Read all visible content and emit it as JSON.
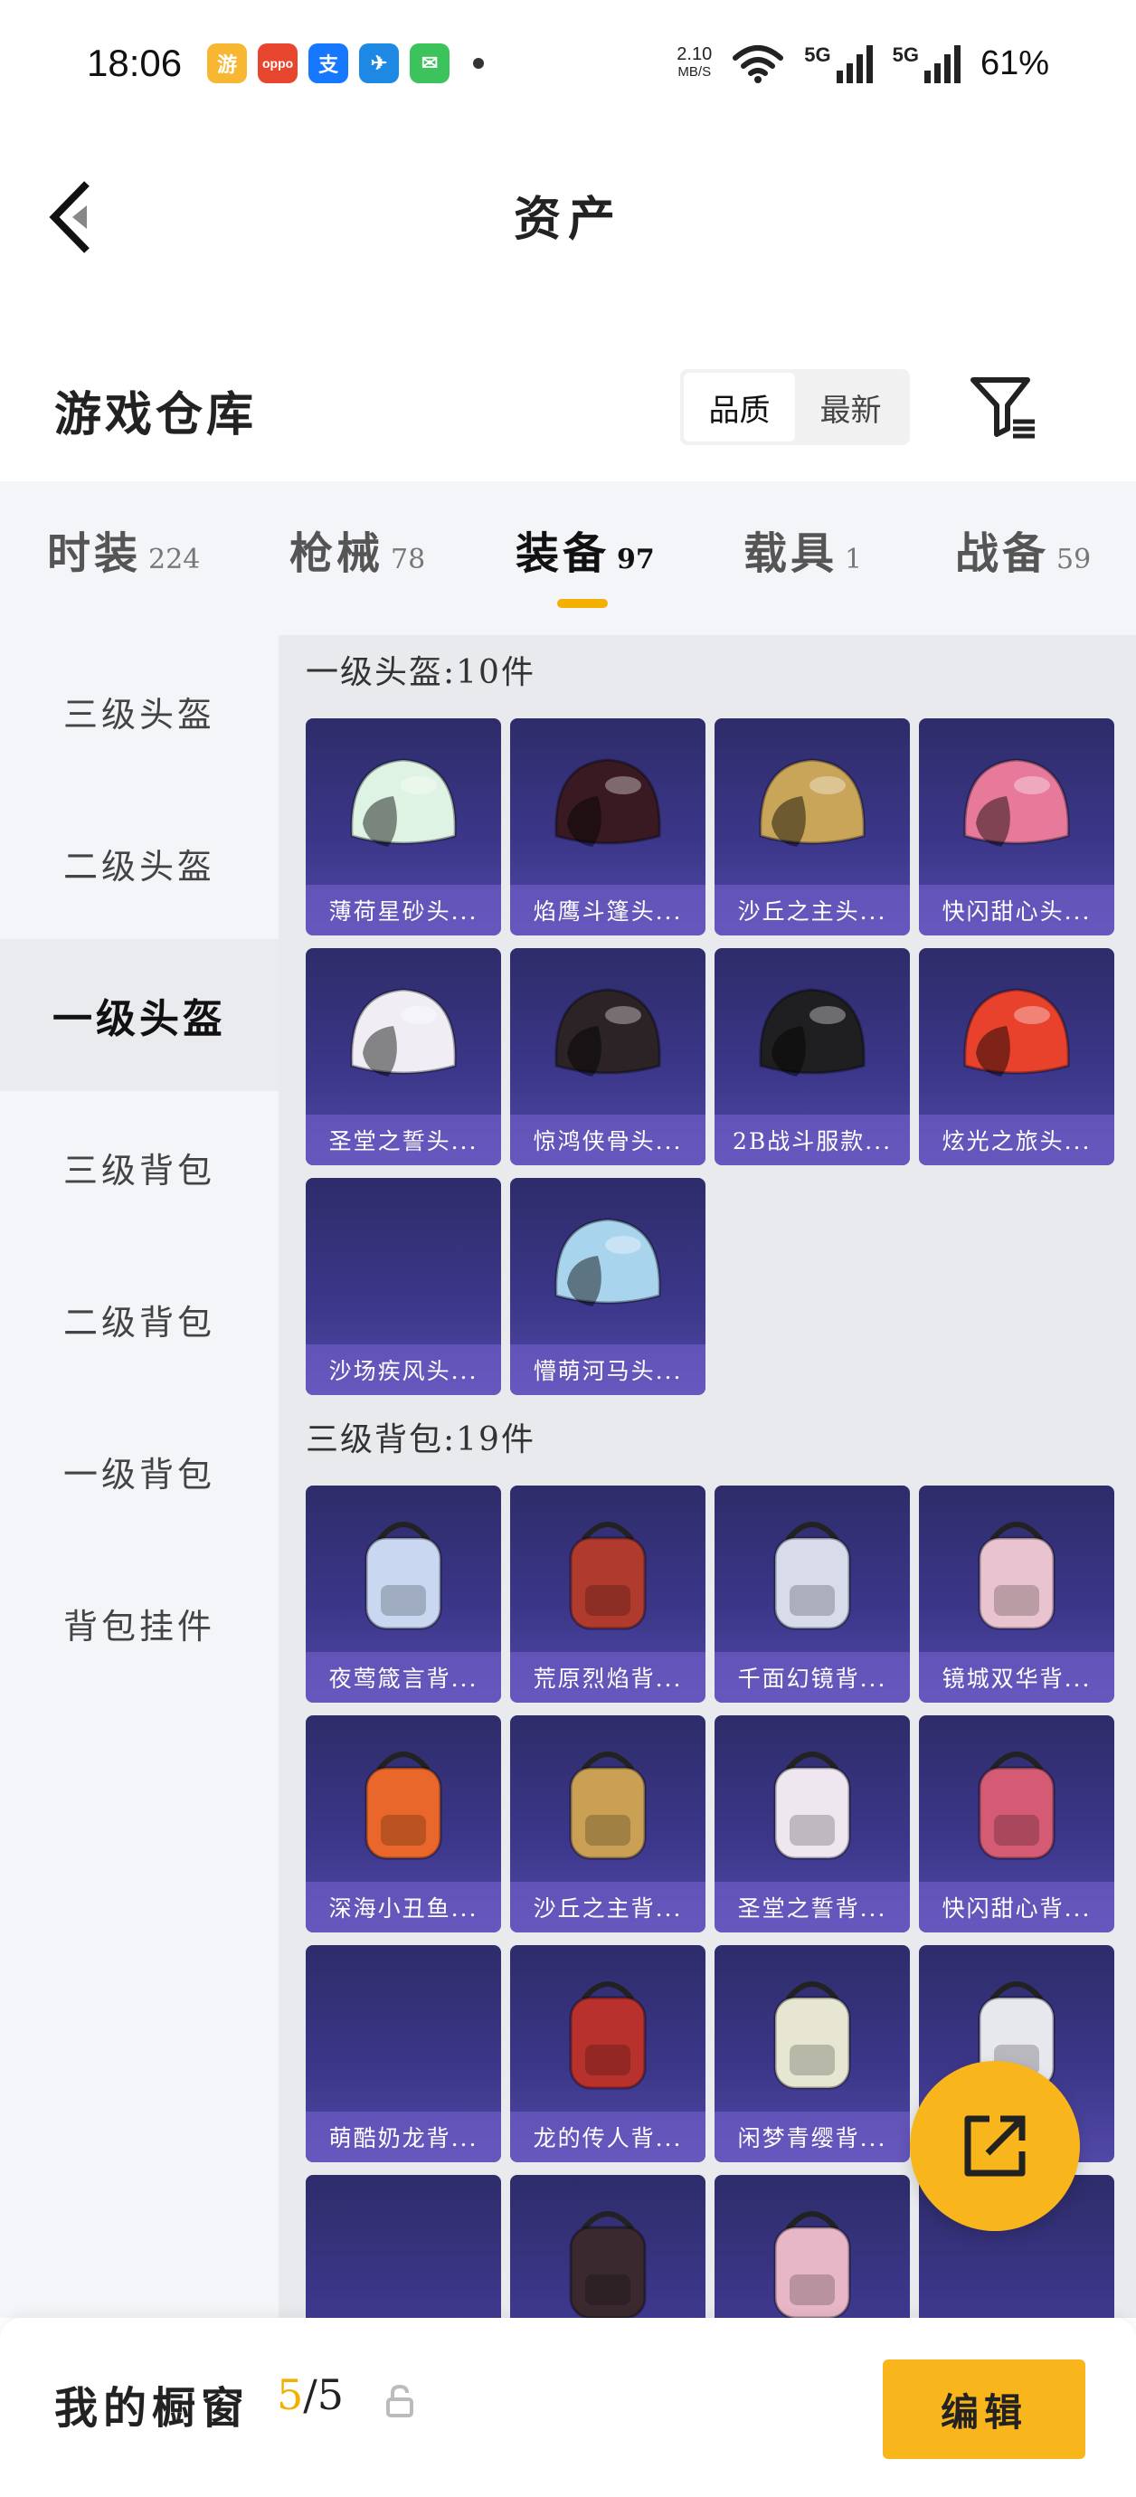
{
  "status_bar": {
    "time": "18:06",
    "speed_value": "2.10",
    "speed_unit": "MB/S",
    "signal1_label": "5G",
    "signal2_label": "5G",
    "battery": "61%",
    "apps": [
      {
        "icon": "game-app-icon",
        "color": "#f7b733"
      },
      {
        "icon": "oppo-store-icon",
        "color": "#e8452f"
      },
      {
        "icon": "alipay-icon",
        "color": "#1677ff"
      },
      {
        "icon": "feishu-icon",
        "color": "#1e88e5"
      },
      {
        "icon": "messages-icon",
        "color": "#3cc35c"
      }
    ]
  },
  "header": {
    "title": "资产"
  },
  "warehouse": {
    "title": "游戏仓库",
    "sort_options": [
      "品质",
      "最新"
    ],
    "active_sort": "品质"
  },
  "tabs": [
    {
      "label": "时装",
      "count": "224"
    },
    {
      "label": "枪械",
      "count": "78"
    },
    {
      "label": "装备",
      "count": "97"
    },
    {
      "label": "载具",
      "count": "1"
    },
    {
      "label": "战备",
      "count": "59"
    }
  ],
  "active_tab": "装备",
  "sidebar": {
    "items": [
      "三级头盔",
      "二级头盔",
      "一级头盔",
      "三级背包",
      "二级背包",
      "一级背包",
      "背包挂件"
    ],
    "active": "一级头盔"
  },
  "groups": [
    {
      "title": "一级头盔:10件",
      "items": [
        {
          "name": "薄荷星砂头...",
          "icon": "helmet-icon",
          "color": "#dff3e4"
        },
        {
          "name": "焰鹰斗篷头...",
          "icon": "helmet-icon",
          "color": "#3a1a22"
        },
        {
          "name": "沙丘之主头...",
          "icon": "helmet-icon",
          "color": "#c9a55a"
        },
        {
          "name": "快闪甜心头...",
          "icon": "helmet-icon",
          "color": "#e77a9a"
        },
        {
          "name": "圣堂之誓头...",
          "icon": "helmet-icon",
          "color": "#f0eef4"
        },
        {
          "name": "惊鸿侠骨头...",
          "icon": "helmet-icon",
          "color": "#2b2326"
        },
        {
          "name": "2B战斗服款...",
          "icon": "helmet-icon",
          "color": "#1f1f22"
        },
        {
          "name": "炫光之旅头...",
          "icon": "helmet-icon",
          "color": "#e8412c"
        },
        {
          "name": "沙场疾风头...",
          "icon": "",
          "color": ""
        },
        {
          "name": "懵萌河马头...",
          "icon": "helmet-icon",
          "color": "#a9d4ee"
        }
      ]
    },
    {
      "title": "三级背包:19件",
      "items": [
        {
          "name": "夜莺箴言背...",
          "icon": "backpack-icon",
          "color": "#c9d7f0"
        },
        {
          "name": "荒原烈焰背...",
          "icon": "backpack-icon",
          "color": "#b13a2f"
        },
        {
          "name": "千面幻镜背...",
          "icon": "backpack-icon",
          "color": "#d7dbea"
        },
        {
          "name": "镜城双华背...",
          "icon": "backpack-icon",
          "color": "#e9c3cf"
        },
        {
          "name": "深海小丑鱼...",
          "icon": "backpack-icon",
          "color": "#e9672a"
        },
        {
          "name": "沙丘之主背...",
          "icon": "backpack-icon",
          "color": "#caa055"
        },
        {
          "name": "圣堂之誓背...",
          "icon": "backpack-icon",
          "color": "#efe7ef"
        },
        {
          "name": "快闪甜心背...",
          "icon": "backpack-icon",
          "color": "#d45b73"
        },
        {
          "name": "萌酷奶龙背...",
          "icon": "",
          "color": ""
        },
        {
          "name": "龙的传人背...",
          "icon": "backpack-icon",
          "color": "#b8312c"
        },
        {
          "name": "闲梦青缨背...",
          "icon": "backpack-icon",
          "color": "#e7e6d2"
        },
        {
          "name": "",
          "icon": "backpack-icon",
          "color": "#e7e7ee"
        },
        {
          "name": "",
          "icon": "",
          "color": ""
        },
        {
          "name": "",
          "icon": "backpack-icon",
          "color": "#3a2a30"
        },
        {
          "name": "",
          "icon": "backpack-icon",
          "color": "#e7b7c7"
        },
        {
          "name": "",
          "icon": "",
          "color": ""
        }
      ]
    }
  ],
  "bottom_bar": {
    "label": "我的橱窗",
    "current": "5",
    "total": "/5",
    "edit_label": "编辑"
  },
  "colors": {
    "accent": "#f4b000",
    "card_top": "#2e2c6a",
    "card_bottom": "#5249a8"
  }
}
